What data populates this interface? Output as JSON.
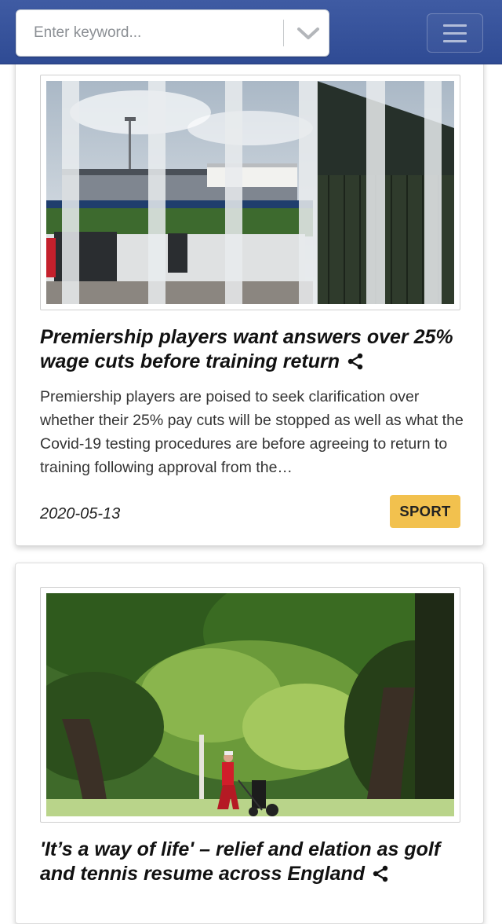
{
  "search": {
    "placeholder": "Enter keyword..."
  },
  "icons": {
    "dropdown": "chevron-down-icon",
    "menu": "hamburger-menu-icon",
    "share": "share-icon"
  },
  "colors": {
    "navbar": "#3a55a0",
    "tag_background": "#f2c14e"
  },
  "articles": [
    {
      "title": "Premiership players want answers over 25% wage cuts before training return",
      "excerpt": "Premiership players are poised to seek clarification over whether their 25% pay cuts will be stopped as well as what the Covid-19 testing procedures are before agreeing to return to training following approval from the…",
      "date": "2020-05-13",
      "category": "SPORT"
    },
    {
      "title": "'It’s a way of life' – relief and elation as golf and tennis resume across England"
    }
  ]
}
